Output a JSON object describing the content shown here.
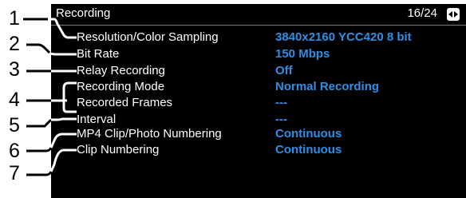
{
  "header": {
    "title": "Recording",
    "page_indicator": "16/24",
    "page_icon": "page-swap-icon"
  },
  "settings": [
    {
      "label": "Resolution/Color Sampling",
      "value": "3840x2160 YCC420 8 bit"
    },
    {
      "label": "Bit Rate",
      "value": "150 Mbps"
    },
    {
      "label": "Relay Recording",
      "value": "Off"
    },
    {
      "label": "Recording Mode",
      "value": "Normal Recording"
    },
    {
      "label": "Recorded Frames",
      "value": "---"
    },
    {
      "label": "Interval",
      "value": "---"
    },
    {
      "label": "MP4 Clip/Photo Numbering",
      "value": "Continuous"
    },
    {
      "label": "Clip Numbering",
      "value": "Continuous"
    }
  ],
  "callouts": [
    "1",
    "2",
    "3",
    "4",
    "5",
    "6",
    "7"
  ],
  "colors": {
    "screen_bg": "#000000",
    "label_text": "#ffffff",
    "value_text": "#2e8fe6",
    "callout_line": "#000000"
  }
}
